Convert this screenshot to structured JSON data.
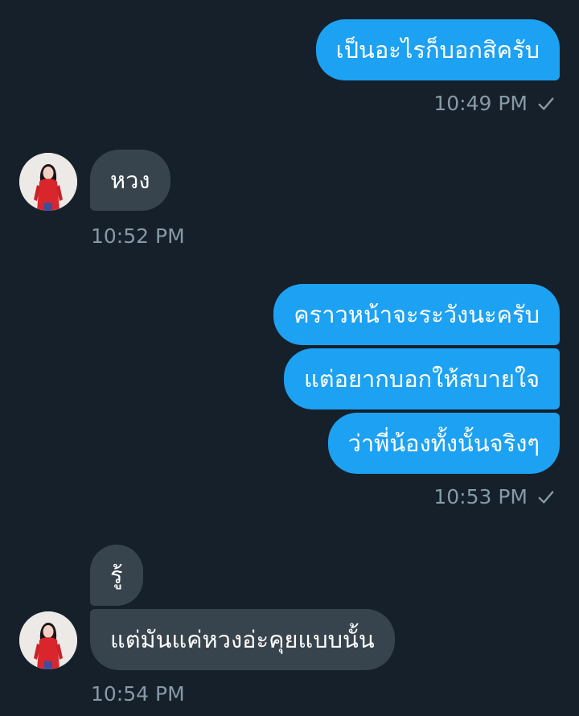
{
  "messages": [
    {
      "id": "m1",
      "direction": "out",
      "text": "เป็นอะไรก็บอกสิครับ"
    },
    {
      "id": "m2",
      "direction": "in",
      "text": "หวง"
    },
    {
      "id": "m3",
      "direction": "out",
      "text": "คราวหน้าจะระวังนะครับ"
    },
    {
      "id": "m4",
      "direction": "out",
      "text": "แต่อยากบอกให้สบายใจ"
    },
    {
      "id": "m5",
      "direction": "out",
      "text": "ว่าพี่น้องทั้งนั้นจริงๆ"
    },
    {
      "id": "m6",
      "direction": "in",
      "text": "รู้"
    },
    {
      "id": "m7",
      "direction": "in",
      "text": "แต่มันแค่หวงอ่ะคุยแบบนั้น"
    }
  ],
  "timestamps": {
    "t1": "10:49 PM",
    "t2": "10:52 PM",
    "t3": "10:53 PM",
    "t4": "10:54 PM"
  },
  "colors": {
    "background": "#15202b",
    "outgoing_bubble": "#1da1f2",
    "incoming_bubble": "#38444d",
    "timestamp": "#8899a6"
  },
  "icons": {
    "read_receipt": "check-icon",
    "avatar": "avatar-photo"
  }
}
